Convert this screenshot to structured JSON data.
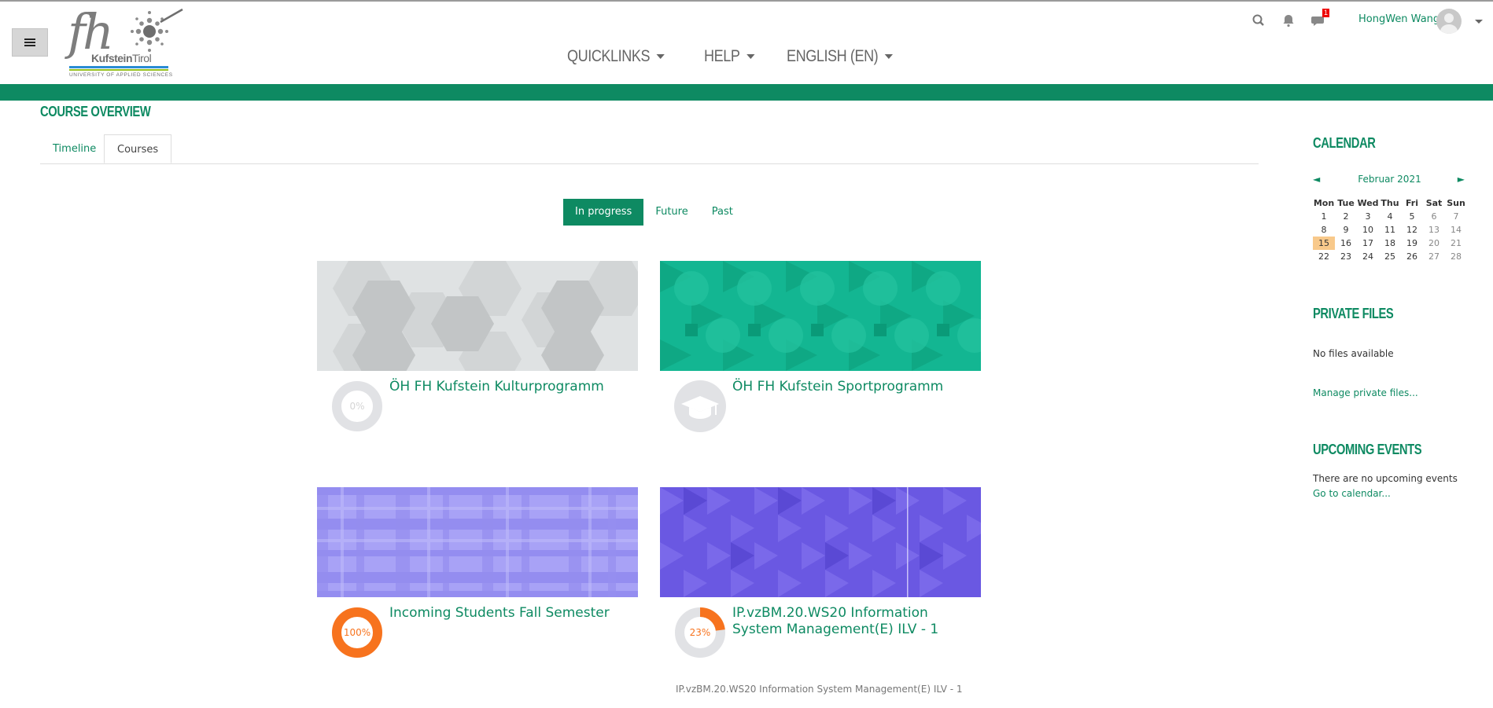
{
  "header": {
    "nav": [
      {
        "label": "QUICKLINKS"
      },
      {
        "label": "HELP"
      },
      {
        "label": "ENGLISH (EN)"
      }
    ],
    "messages_badge": "1",
    "user_name": "HongWen Wang",
    "logo": {
      "wordmark": "fh",
      "sub_bold": "Kufstein",
      "sub_rest": "Tirol",
      "univ": "UNIVERSITY OF APPLIED SCIENCES"
    }
  },
  "colors": {
    "brand": "#0e8a62",
    "progress": "#f7731e",
    "today": "#f8c98b"
  },
  "course_overview": {
    "title": "COURSE OVERVIEW",
    "tabs": [
      {
        "label": "Timeline"
      },
      {
        "label": "Courses"
      }
    ],
    "filters": [
      {
        "label": "In progress"
      },
      {
        "label": "Future"
      },
      {
        "label": "Past"
      }
    ],
    "courses": [
      {
        "title": "ÖH FH Kufstein Kulturprogramm",
        "progress_label": "0%",
        "progress": 0
      },
      {
        "title": "ÖH FH Kufstein Sportprogramm",
        "icon": "graduation-cap-icon"
      },
      {
        "title": "Incoming Students Fall Semester",
        "progress_label": "100%",
        "progress": 100
      },
      {
        "title": "IP.vzBM.20.WS20 Information System Management(E) ILV - 1",
        "progress_label": "23%",
        "progress": 23,
        "subtitle": "IP.vzBM.20.WS20 Information System Management(E) ILV - 1"
      }
    ]
  },
  "calendar": {
    "title": "CALENDAR",
    "month": "Februar 2021",
    "prev": "◄",
    "next": "►",
    "weekdays": [
      "Mon",
      "Tue",
      "Wed",
      "Thu",
      "Fri",
      "Sat",
      "Sun"
    ],
    "weeks": [
      [
        "1",
        "2",
        "3",
        "4",
        "5",
        "6",
        "7"
      ],
      [
        "8",
        "9",
        "10",
        "11",
        "12",
        "13",
        "14"
      ],
      [
        "15",
        "16",
        "17",
        "18",
        "19",
        "20",
        "21"
      ],
      [
        "22",
        "23",
        "24",
        "25",
        "26",
        "27",
        "28"
      ]
    ],
    "today": "15"
  },
  "private_files": {
    "title": "PRIVATE FILES",
    "empty_text": "No files available",
    "manage_link": "Manage private files..."
  },
  "upcoming_events": {
    "title": "UPCOMING EVENTS",
    "empty_text": "There are no upcoming events",
    "calendar_link": "Go to calendar..."
  }
}
